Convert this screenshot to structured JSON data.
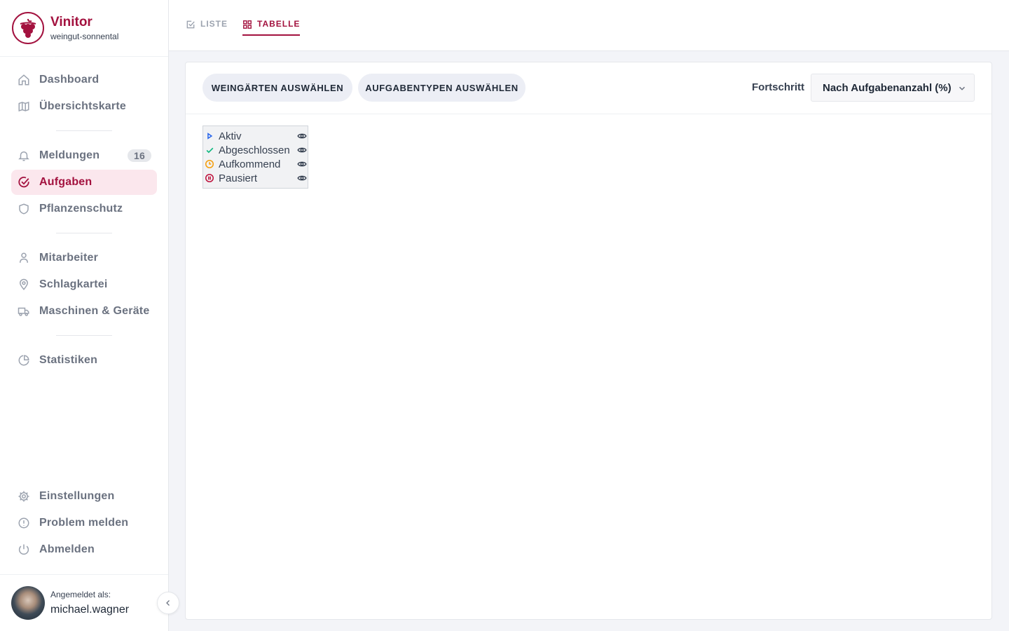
{
  "brand": {
    "name": "Vinitor",
    "subtitle": "weingut-sonnental"
  },
  "sidebar": {
    "group1": [
      {
        "label": "Dashboard",
        "icon": "home-icon"
      },
      {
        "label": "Übersichtskarte",
        "icon": "map-icon"
      }
    ],
    "group2": [
      {
        "label": "Meldungen",
        "icon": "bell-icon",
        "badge": "16"
      },
      {
        "label": "Aufgaben",
        "icon": "check-circle-icon",
        "active": true
      },
      {
        "label": "Pflanzenschutz",
        "icon": "shield-icon"
      }
    ],
    "group3": [
      {
        "label": "Mitarbeiter",
        "icon": "user-icon"
      },
      {
        "label": "Schlagkartei",
        "icon": "map-pin-icon"
      },
      {
        "label": "Maschinen & Geräte",
        "icon": "truck-icon"
      }
    ],
    "group4": [
      {
        "label": "Statistiken",
        "icon": "pie-chart-icon"
      }
    ],
    "bottom": [
      {
        "label": "Einstellungen",
        "icon": "gear-icon"
      },
      {
        "label": "Problem melden",
        "icon": "alert-circle-icon"
      },
      {
        "label": "Abmelden",
        "icon": "power-icon"
      }
    ]
  },
  "user": {
    "label": "Angemeldet als:",
    "name": "michael.wagner"
  },
  "tabs": {
    "list": "LISTE",
    "table": "TABELLE"
  },
  "toolbar": {
    "vineyards_button": "WEINGÄRTEN AUSWÄHLEN",
    "tasktypes_button": "AUFGABENTYPEN AUSWÄHLEN",
    "progress_label": "Fortschritt",
    "progress_select": "Nach Aufgabenanzahl (%)"
  },
  "legend": [
    {
      "label": "Aktiv",
      "icon": "play-icon",
      "color": "#2563eb"
    },
    {
      "label": "Abgeschlossen",
      "icon": "check-icon",
      "color": "#10b981"
    },
    {
      "label": "Aufkommend",
      "icon": "clock-icon",
      "color": "#f59e0b"
    },
    {
      "label": "Pausiert",
      "icon": "pause-circle-icon",
      "color": "#be123c"
    }
  ],
  "colors": {
    "accent": "#a3123f",
    "active_bg": "#fbe7ed"
  }
}
